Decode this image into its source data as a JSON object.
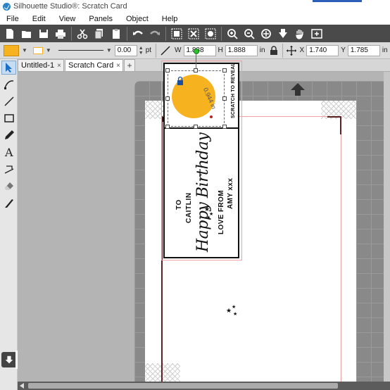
{
  "window": {
    "title": "Silhouette Studio®: Scratch Card"
  },
  "menu": [
    "File",
    "Edit",
    "View",
    "Panels",
    "Object",
    "Help"
  ],
  "toolbar_icons": [
    "new-icon",
    "open-icon",
    "save-icon",
    "print-icon",
    "cut-icon",
    "copy-icon",
    "paste-icon",
    "undo-icon",
    "redo-icon",
    "group-icon",
    "ungroup-icon",
    "release-icon",
    "zoom-in-icon",
    "zoom-out-icon",
    "zoom-fit-icon",
    "move-down-icon",
    "pan-icon",
    "add-page-icon"
  ],
  "properties": {
    "fill_color": "#f7b21f",
    "line_color": "#f7b21f",
    "line_weight": "0.00",
    "line_unit": "pt",
    "w_label": "W",
    "w_value": "1.888",
    "h_label": "H",
    "h_value": "1.888",
    "size_unit": "in",
    "x_label": "X",
    "x_value": "1.740",
    "y_label": "Y",
    "y_value": "1.785",
    "pos_unit": "in"
  },
  "tabs": [
    {
      "label": "Untitled-1",
      "close": "×"
    },
    {
      "label": "Scratch Card",
      "close": "×"
    }
  ],
  "add_tab": "+",
  "design": {
    "scratch_label": "SCRATCH TO REVEAL",
    "dimension_label": "0.944 in",
    "to_line": "TO",
    "name_line": "CAITLIN",
    "script_line": "Happy Birthday",
    "love_line": "LOVE FROM",
    "sender_line": "AMY xxx"
  },
  "colors": {
    "accent_fill": "#f7b21f",
    "rotate_handle": "#2ec12e",
    "margin_line": "#f0a0a0"
  }
}
